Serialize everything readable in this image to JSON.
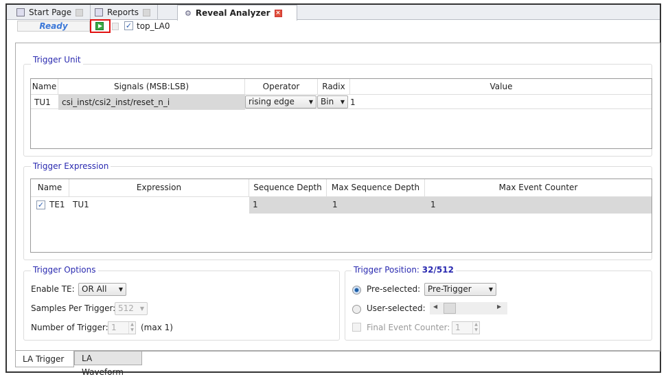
{
  "tabs": [
    {
      "label": "Start Page",
      "icon": "start-page-icon"
    },
    {
      "label": "Reports",
      "icon": "reports-icon"
    },
    {
      "label": "Reveal Analyzer",
      "icon": "reveal-analyzer-icon",
      "active": true
    }
  ],
  "toolbar": {
    "status": "Ready",
    "core_label": "top_LA0",
    "core_checked": true
  },
  "trigger_unit": {
    "title": "Trigger Unit",
    "columns": [
      "Name",
      "Signals (MSB:LSB)",
      "Operator",
      "Radix",
      "Value"
    ],
    "rows": [
      {
        "name": "TU1",
        "signals": "csi_inst/csi2_inst/reset_n_i",
        "operator": "rising edge",
        "radix": "Bin",
        "value": "1"
      }
    ]
  },
  "trigger_expression": {
    "title": "Trigger Expression",
    "columns": [
      "Name",
      "Expression",
      "Sequence Depth",
      "Max Sequence Depth",
      "Max Event Counter"
    ],
    "rows": [
      {
        "checked": true,
        "name": "TE1",
        "expression": "TU1",
        "sequence_depth": "1",
        "max_sequence_depth": "1",
        "max_event_counter": "1"
      }
    ]
  },
  "trigger_options": {
    "title": "Trigger Options",
    "enable_te_label": "Enable TE:",
    "enable_te_value": "OR All",
    "samples_label": "Samples Per Trigger:",
    "samples_value": "512",
    "num_trigger_label": "Number of Trigger:",
    "num_trigger_value": "1",
    "num_trigger_max": "(max 1)"
  },
  "trigger_position": {
    "title": "Trigger Position:",
    "value": "32/512",
    "preselected_label": "Pre-selected:",
    "preselected_value": "Pre-Trigger",
    "userselected_label": "User-selected:",
    "final_counter_label": "Final Event Counter:",
    "final_counter_value": "1"
  },
  "bottom_tabs": [
    "LA Trigger",
    "LA Waveform"
  ],
  "colors": {
    "accent": "#2a2ab0",
    "highlight": "#e01010",
    "status": "#3c78d8"
  }
}
